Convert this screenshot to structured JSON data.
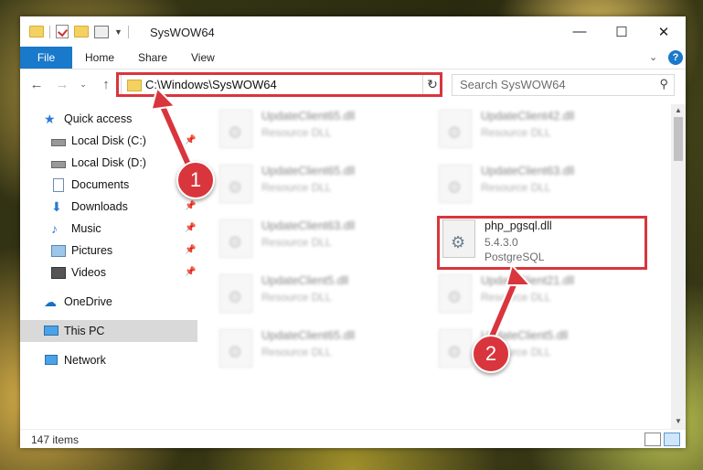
{
  "window": {
    "title": "SysWOW64"
  },
  "ribbon": {
    "file": "File",
    "tabs": [
      "Home",
      "Share",
      "View"
    ]
  },
  "address": {
    "path": "C:\\Windows\\SysWOW64"
  },
  "search": {
    "placeholder": "Search SysWOW64"
  },
  "sidebar": {
    "items": [
      {
        "label": "Quick access"
      },
      {
        "label": "Local Disk (C:)"
      },
      {
        "label": "Local Disk (D:)"
      },
      {
        "label": "Documents"
      },
      {
        "label": "Downloads"
      },
      {
        "label": "Music"
      },
      {
        "label": "Pictures"
      },
      {
        "label": "Videos"
      },
      {
        "label": "OneDrive"
      },
      {
        "label": "This PC"
      },
      {
        "label": "Network"
      }
    ]
  },
  "files": [
    {
      "name": "UpdateClient65.dll",
      "line1": "Resource DLL",
      "line2": ""
    },
    {
      "name": "UpdateClient42.dll",
      "line1": "Resource DLL",
      "line2": ""
    },
    {
      "name": "UpdateClient65.dll",
      "line1": "Resource DLL",
      "line2": ""
    },
    {
      "name": "UpdateClient63.dll",
      "line1": "Resource DLL",
      "line2": ""
    },
    {
      "name": "UpdateClient63.dll",
      "line1": "Resource DLL",
      "line2": ""
    },
    {
      "name": "php_pgsql.dll",
      "line1": "5.4.3.0",
      "line2": "PostgreSQL"
    },
    {
      "name": "UpdateClient5.dll",
      "line1": "Resource DLL",
      "line2": ""
    },
    {
      "name": "UpdateClient21.dll",
      "line1": "Resource DLL",
      "line2": ""
    },
    {
      "name": "UpdateClient65.dll",
      "line1": "Resource DLL",
      "line2": ""
    },
    {
      "name": "UpdateClient5.dll",
      "line1": "Resource DLL",
      "line2": ""
    }
  ],
  "status": {
    "count": "147 items"
  },
  "annotations": {
    "step1": "1",
    "step2": "2"
  },
  "colors": {
    "accent": "#1979ca",
    "highlight": "#d9353d"
  }
}
